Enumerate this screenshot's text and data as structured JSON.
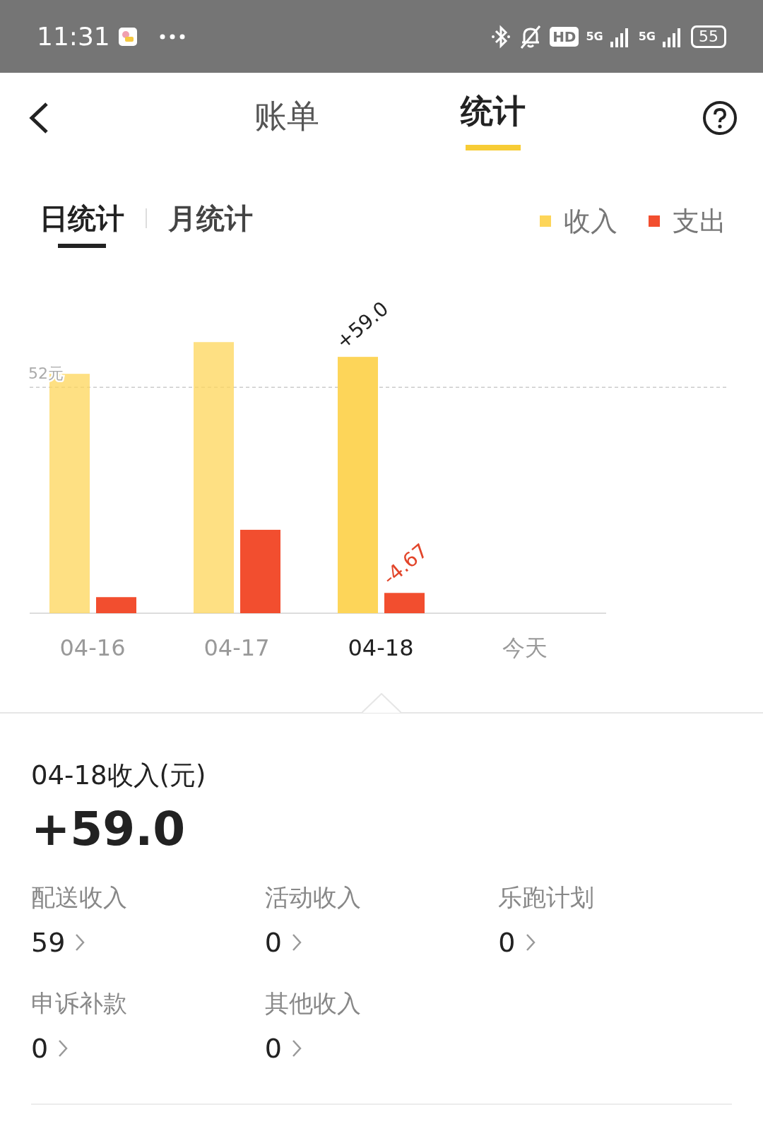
{
  "status_bar": {
    "time": "11:31",
    "hd": "HD",
    "network": [
      "5G",
      "5G"
    ],
    "battery": "55"
  },
  "header": {
    "tabs": [
      {
        "label": "账单",
        "selected": false
      },
      {
        "label": "统计",
        "selected": true
      }
    ]
  },
  "period_tabs": [
    {
      "label": "日统计",
      "selected": true
    },
    {
      "label": "月统计",
      "selected": false
    }
  ],
  "legend": [
    {
      "label": "收入",
      "color": "#fdd559"
    },
    {
      "label": "支出",
      "color": "#f24e2f"
    }
  ],
  "chart": {
    "reference_label": "52元",
    "days": [
      {
        "label": "04-16",
        "selected": false
      },
      {
        "label": "04-17",
        "selected": false
      },
      {
        "label": "04-18",
        "selected": true
      },
      {
        "label": "今天",
        "selected": false
      }
    ],
    "income_label": "+59.0",
    "expense_label": "-4.67"
  },
  "detail": {
    "title": "04-18收入(元)",
    "total": "+59.0",
    "items": [
      {
        "label": "配送收入",
        "value": "59"
      },
      {
        "label": "活动收入",
        "value": "0"
      },
      {
        "label": "乐跑计划",
        "value": "0"
      },
      {
        "label": "申诉补款",
        "value": "0"
      },
      {
        "label": "其他收入",
        "value": "0"
      }
    ]
  }
}
